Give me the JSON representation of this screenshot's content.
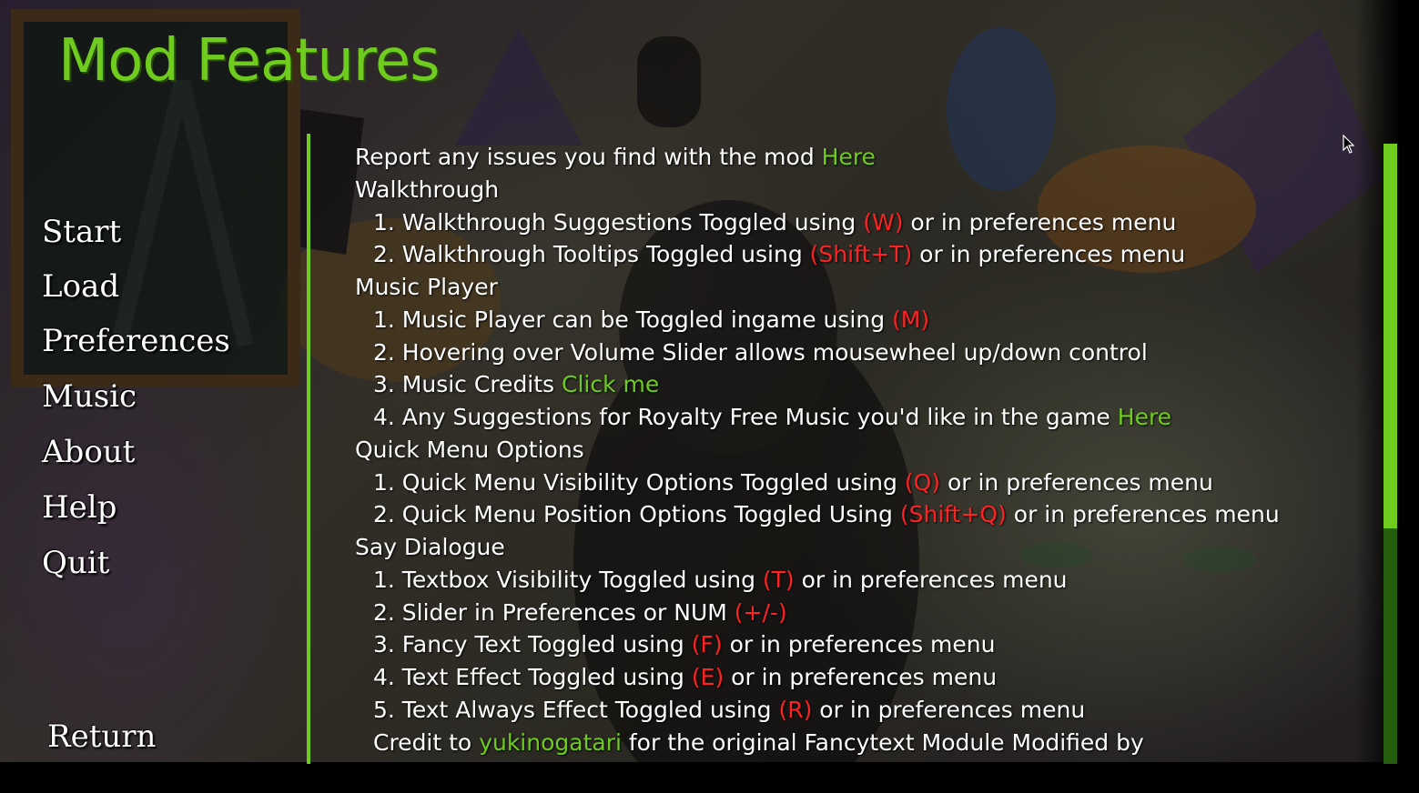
{
  "screen": {
    "title": "Mod Features"
  },
  "nav": {
    "items": [
      {
        "label": "Start",
        "name": "nav-start"
      },
      {
        "label": "Load",
        "name": "nav-load"
      },
      {
        "label": "Preferences",
        "name": "nav-preferences"
      },
      {
        "label": "Music",
        "name": "nav-music"
      },
      {
        "label": "About",
        "name": "nav-about"
      },
      {
        "label": "Help",
        "name": "nav-help"
      },
      {
        "label": "Quit",
        "name": "nav-quit"
      }
    ],
    "return_label": "Return"
  },
  "content": {
    "lines": [
      {
        "indent": false,
        "name": "report-issues-line",
        "segments": [
          {
            "text": "Report any issues you find with the mod ",
            "style": "plain"
          },
          {
            "text": "Here",
            "style": "link"
          }
        ]
      },
      {
        "indent": false,
        "name": "section-heading",
        "segments": [
          {
            "text": "Walkthrough",
            "style": "plain"
          }
        ]
      },
      {
        "indent": true,
        "name": "feature-item",
        "segments": [
          {
            "text": "1. Walkthrough Suggestions Toggled using ",
            "style": "plain"
          },
          {
            "text": "(W)",
            "style": "key"
          },
          {
            "text": " or in preferences menu",
            "style": "plain"
          }
        ]
      },
      {
        "indent": true,
        "name": "feature-item",
        "segments": [
          {
            "text": "2. Walkthrough Tooltips Toggled using ",
            "style": "plain"
          },
          {
            "text": "(Shift+T)",
            "style": "key"
          },
          {
            "text": " or in preferences menu",
            "style": "plain"
          }
        ]
      },
      {
        "indent": false,
        "name": "section-heading",
        "segments": [
          {
            "text": "Music Player",
            "style": "plain"
          }
        ]
      },
      {
        "indent": true,
        "name": "feature-item",
        "segments": [
          {
            "text": "1. Music Player can be Toggled ingame using ",
            "style": "plain"
          },
          {
            "text": "(M)",
            "style": "key"
          }
        ]
      },
      {
        "indent": true,
        "name": "feature-item",
        "segments": [
          {
            "text": "2. Hovering over Volume Slider allows mousewheel up/down control",
            "style": "plain"
          }
        ]
      },
      {
        "indent": true,
        "name": "feature-item",
        "segments": [
          {
            "text": "3. Music Credits ",
            "style": "plain"
          },
          {
            "text": "Click me",
            "style": "link"
          }
        ]
      },
      {
        "indent": true,
        "name": "feature-item",
        "segments": [
          {
            "text": "4. Any Suggestions for Royalty Free Music you'd like in the game ",
            "style": "plain"
          },
          {
            "text": "Here",
            "style": "link"
          }
        ]
      },
      {
        "indent": false,
        "name": "section-heading",
        "segments": [
          {
            "text": "Quick Menu Options",
            "style": "plain"
          }
        ]
      },
      {
        "indent": true,
        "name": "feature-item",
        "segments": [
          {
            "text": "1. Quick Menu Visibility Options Toggled using ",
            "style": "plain"
          },
          {
            "text": "(Q)",
            "style": "key"
          },
          {
            "text": " or in preferences menu",
            "style": "plain"
          }
        ]
      },
      {
        "indent": true,
        "name": "feature-item",
        "segments": [
          {
            "text": "2. Quick Menu Position Options Toggled Using ",
            "style": "plain"
          },
          {
            "text": "(Shift+Q)",
            "style": "key"
          },
          {
            "text": " or in preferences menu",
            "style": "plain"
          }
        ]
      },
      {
        "indent": false,
        "name": "section-heading",
        "segments": [
          {
            "text": "Say Dialogue",
            "style": "plain"
          }
        ]
      },
      {
        "indent": true,
        "name": "feature-item",
        "segments": [
          {
            "text": "1. Textbox Visibility Toggled using ",
            "style": "plain"
          },
          {
            "text": "(T)",
            "style": "key"
          },
          {
            "text": " or in preferences menu",
            "style": "plain"
          }
        ]
      },
      {
        "indent": true,
        "name": "feature-item",
        "segments": [
          {
            "text": "2. Slider in Preferences or NUM ",
            "style": "plain"
          },
          {
            "text": "(+/-)",
            "style": "key"
          }
        ]
      },
      {
        "indent": true,
        "name": "feature-item",
        "segments": [
          {
            "text": "3. Fancy Text Toggled using ",
            "style": "plain"
          },
          {
            "text": "(F)",
            "style": "key"
          },
          {
            "text": " or in preferences menu",
            "style": "plain"
          }
        ]
      },
      {
        "indent": true,
        "name": "feature-item",
        "segments": [
          {
            "text": "4. Text Effect Toggled using ",
            "style": "plain"
          },
          {
            "text": "(E)",
            "style": "key"
          },
          {
            "text": " or in preferences menu",
            "style": "plain"
          }
        ]
      },
      {
        "indent": true,
        "name": "feature-item",
        "segments": [
          {
            "text": "5. Text Always Effect Toggled using ",
            "style": "plain"
          },
          {
            "text": "(R)",
            "style": "key"
          },
          {
            "text": " or in preferences menu",
            "style": "plain"
          }
        ]
      },
      {
        "indent": true,
        "name": "credit-line",
        "segments": [
          {
            "text": "Credit to ",
            "style": "plain"
          },
          {
            "text": "yukinogatari",
            "style": "link"
          },
          {
            "text": " for the original Fancytext Module Modified by",
            "style": "plain"
          }
        ]
      }
    ]
  },
  "colors": {
    "accent": "#6fcc1f",
    "key": "#ff2222",
    "text": "#ffffff",
    "frame": "#3b2a17"
  },
  "scrollbar": {
    "position_fraction": 0,
    "visible_fraction": 0.62
  },
  "icons": {
    "cursor": "mouse-pointer-icon"
  }
}
